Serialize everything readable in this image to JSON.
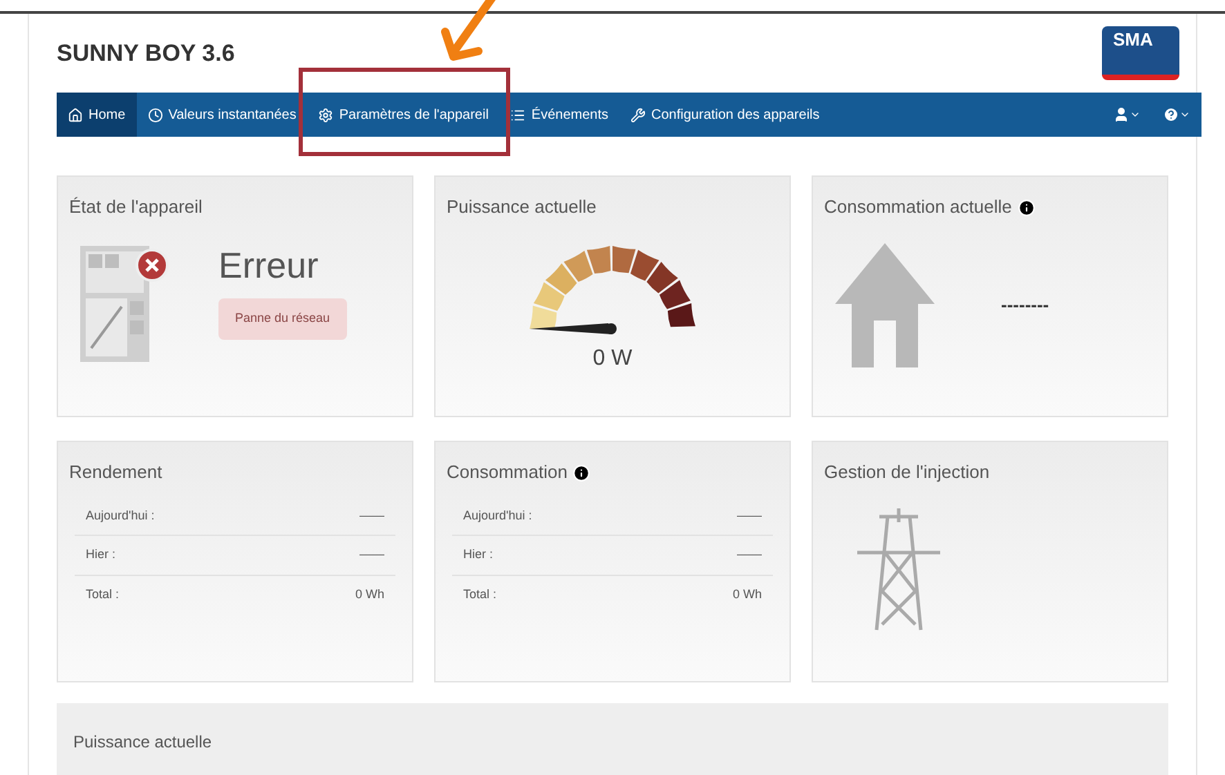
{
  "header": {
    "title": "SUNNY BOY 3.6",
    "logo": "SMA"
  },
  "nav": {
    "items": [
      {
        "label": "Home",
        "selected": true
      },
      {
        "label": "Valeurs instantanées",
        "selected": false
      },
      {
        "label": "Paramètres de l'appareil",
        "selected": false,
        "highlighted": true
      },
      {
        "label": "Événements",
        "selected": false
      },
      {
        "label": "Configuration des appareils",
        "selected": false
      }
    ]
  },
  "cards": [
    {
      "kind": "status",
      "title": "État de l'appareil",
      "status": "Erreur",
      "badge": "Panne du réseau"
    },
    {
      "kind": "gauge",
      "title": "Puissance actuelle",
      "reading": "0 W"
    },
    {
      "kind": "house",
      "title": "Consommation actuelle",
      "info": true,
      "reading": "--------"
    },
    {
      "kind": "table",
      "title": "Rendement",
      "info": false,
      "rows": [
        {
          "label": "Aujourd'hui :",
          "value": "——"
        },
        {
          "label": "Hier :",
          "value": "——"
        },
        {
          "label": "Total :",
          "value": "0 Wh"
        }
      ]
    },
    {
      "kind": "table",
      "title": "Consommation",
      "info": true,
      "rows": [
        {
          "label": "Aujourd'hui :",
          "value": "——"
        },
        {
          "label": "Hier :",
          "value": "——"
        },
        {
          "label": "Total :",
          "value": "0 Wh"
        }
      ]
    },
    {
      "kind": "pylon",
      "title": "Gestion de l'injection"
    }
  ],
  "bottom_panel": {
    "title": "Puissance actuelle"
  }
}
